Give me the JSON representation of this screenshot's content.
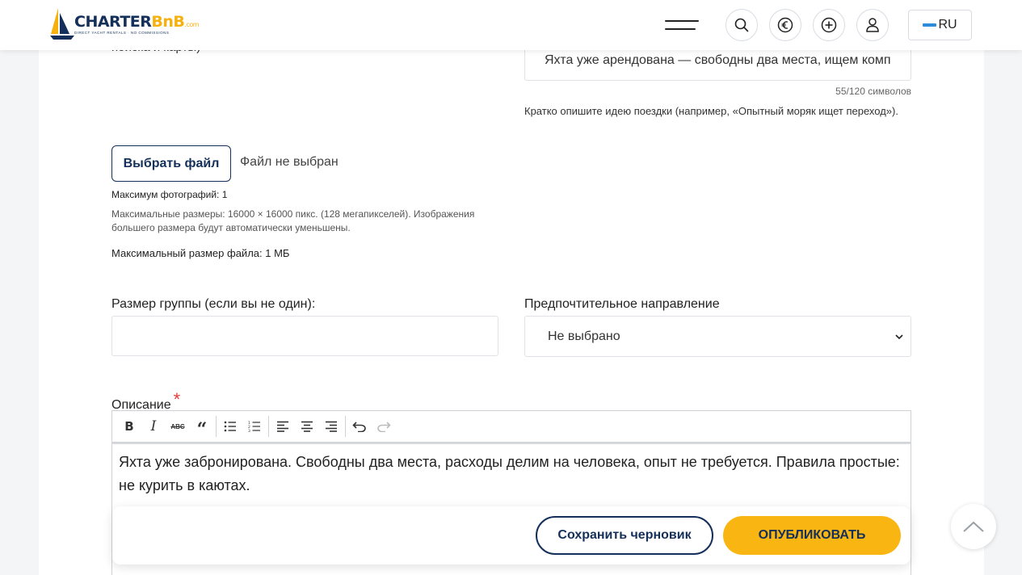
{
  "header": {
    "logo_text_main": "CHARTER",
    "logo_text_accent": "BnB",
    "logo_text_com": ".com",
    "logo_tagline": "DIRECT YACHT RENTALS · NO COMMISSIONS",
    "lang_label": "RU",
    "icons": [
      "menu-icon",
      "search-icon",
      "euro-icon",
      "plus-circle-icon",
      "user-icon"
    ]
  },
  "form": {
    "cut_label": "поиска и карты)",
    "title_value": "Яхта уже арендована — свободны два места, ищем комп",
    "title_counter": "55/120 символов",
    "title_hint": "Кратко опишите идею поездки (например, «Опытный моряк ищет переход»).",
    "file_button": "Выбрать файл",
    "file_status": "Файл не выбран",
    "max_photos": "Максимум фотографий: 1",
    "max_dimensions": "Максимальные размеры: 16000 × 16000 пикс. (128 мегапикселей). Изображения большего размера будут автоматически уменьшены.",
    "max_file_size": "Максимальный размер файла: 1 МБ",
    "group_size_label": "Размер группы (если вы не один):",
    "group_size_value": "",
    "direction_label": "Предпочтительное направление",
    "direction_selected": "Не выбрано",
    "description_label": "Описание",
    "required_mark": "*",
    "description_text": "Яхта уже забронирована. Свободны два места, расходы делим на человека, опыт не требуется. Правила простые: не курить в каютах."
  },
  "toolbar": {
    "bold": "B",
    "italic": "I",
    "strike": "ABC",
    "quote": "“"
  },
  "actions": {
    "save_draft": "Сохранить черновик",
    "publish": "ОПУБЛИКОВАТЬ"
  },
  "colors": {
    "brand_navy": "#14305a",
    "brand_yellow": "#f9b613",
    "required_red": "#e53935"
  }
}
